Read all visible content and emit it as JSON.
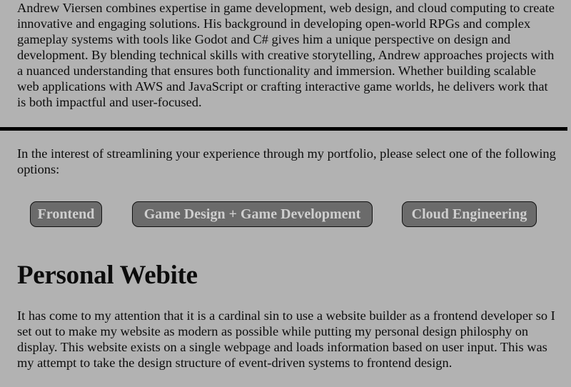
{
  "intro": {
    "text": "Andrew Viersen combines expertise in game development, web design, and cloud computing to create innovative and engaging solutions. His background in developing open-world RPGs and complex gameplay systems with tools like Godot and C# gives him a unique perspective on design and development. By blending technical skills with creative storytelling, Andrew approaches projects with a nuanced understanding that ensures both functionality and immersion. Whether building scalable web applications with AWS and JavaScript or crafting interactive game worlds, he delivers work that is both impactful and user-focused."
  },
  "prompt": {
    "text": "In the interest of streamlining your experience through my portfolio, please select one of the following options:"
  },
  "options": [
    {
      "label": "Frontend"
    },
    {
      "label": "Game Design + Game Development"
    },
    {
      "label": "Cloud Engineering"
    }
  ],
  "section": {
    "title": "Personal Webite",
    "body": "It has come to my attention that it is a cardinal sin to use a website builder as a frontend developer so I set out to make my website as modern as possible while putting my personal design philosphy on display. This website exists on a single webpage and loads information based on user input. This was my attempt to take the design structure of event-driven systems to frontend design."
  },
  "colors": {
    "background": "#b2b2b2",
    "button_fill": "#6b6b6b",
    "button_text": "#cfcfcf",
    "rule": "#000000"
  }
}
